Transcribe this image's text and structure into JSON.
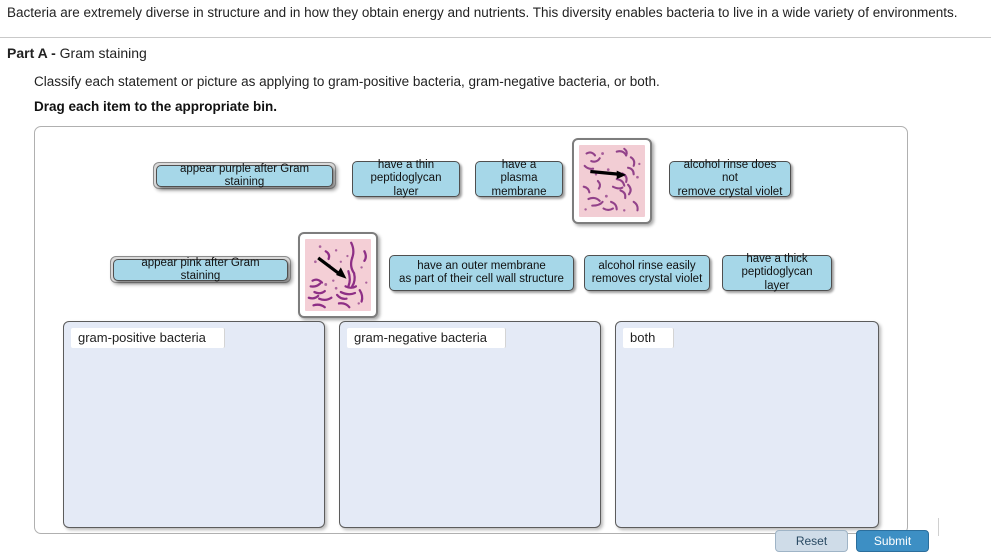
{
  "intro": {
    "text": "Bacteria are extremely diverse in structure and in how they obtain energy and nutrients. This diversity enables bacteria to live in a wide variety of environments."
  },
  "part": {
    "label": "Part A",
    "dash": " - ",
    "title": "Gram staining",
    "instruction": "Classify each statement or picture as applying to gram-positive bacteria, gram-negative bacteria, or both.",
    "drag_note": "Drag each item to the appropriate bin."
  },
  "items": [
    {
      "id": "item-appear-purple",
      "type": "text",
      "label": "appear purple after Gram staining"
    },
    {
      "id": "item-thin-peptidoglycan",
      "type": "text",
      "label": "have a thin\npeptidoglycan layer",
      "line1": "have a thin",
      "line2": "peptidoglycan layer"
    },
    {
      "id": "item-plasma-membrane",
      "type": "text",
      "label": "have a plasma\nmembrane",
      "line1": "have a plasma",
      "line2": "membrane"
    },
    {
      "id": "item-micrograph-purple",
      "type": "image",
      "label": "gram-positive micrograph",
      "alt": "micrograph of purple-stained bacteria with black arrow"
    },
    {
      "id": "item-alcohol-not-remove",
      "type": "text",
      "label": "alcohol rinse does not\nremove crystal violet",
      "line1": "alcohol rinse does not",
      "line2": "remove crystal violet"
    },
    {
      "id": "item-appear-pink",
      "type": "text",
      "label": "appear pink after Gram staining"
    },
    {
      "id": "item-micrograph-pink",
      "type": "image",
      "label": "gram-negative micrograph",
      "alt": "micrograph of pink-stained bacteria with black arrow"
    },
    {
      "id": "item-outer-membrane",
      "type": "text",
      "label": "have an outer membrane\nas part of their cell wall structure",
      "line1": "have an outer membrane",
      "line2": "as part of their cell wall structure"
    },
    {
      "id": "item-alcohol-removes",
      "type": "text",
      "label": "alcohol rinse easily\nremoves crystal violet",
      "line1": "alcohol rinse easily",
      "line2": "removes crystal violet"
    },
    {
      "id": "item-thick-peptidoglycan",
      "type": "text",
      "label": "have a thick\npeptidoglycan layer",
      "line1": "have a thick",
      "line2": "peptidoglycan layer"
    }
  ],
  "bins": [
    {
      "id": "bin-gram-positive",
      "label": "gram-positive bacteria",
      "contents": []
    },
    {
      "id": "bin-gram-negative",
      "label": "gram-negative bacteria",
      "contents": []
    },
    {
      "id": "bin-both",
      "label": "both",
      "contents": []
    }
  ],
  "buttons": {
    "reset": "Reset",
    "submit": "Submit"
  },
  "colors": {
    "tile_fill": "#a6d7e8",
    "bin_fill": "#e4eaf6",
    "submit": "#3d8fc4",
    "reset": "#cfdce8",
    "border": "#4f4f4f"
  }
}
